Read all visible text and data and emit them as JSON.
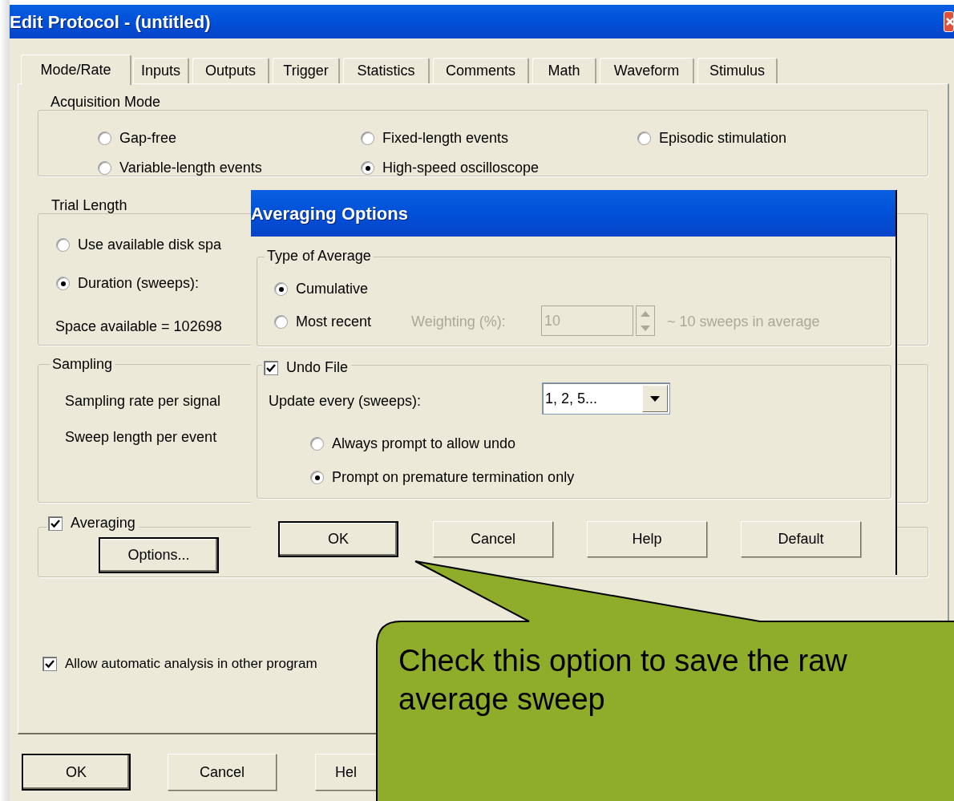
{
  "window": {
    "title": "Edit Protocol - (untitled)"
  },
  "tabs": [
    {
      "label": "Mode/Rate",
      "selected": true
    },
    {
      "label": "Inputs",
      "selected": false
    },
    {
      "label": "Outputs",
      "selected": false
    },
    {
      "label": "Trigger",
      "selected": false
    },
    {
      "label": "Statistics",
      "selected": false
    },
    {
      "label": "Comments",
      "selected": false
    },
    {
      "label": "Math",
      "selected": false
    },
    {
      "label": "Waveform",
      "selected": false
    },
    {
      "label": "Stimulus",
      "selected": false
    }
  ],
  "acquisition_mode": {
    "label": "Acquisition Mode",
    "options": [
      {
        "label": "Gap-free",
        "selected": false
      },
      {
        "label": "Fixed-length events",
        "selected": false
      },
      {
        "label": "Episodic stimulation",
        "selected": false
      },
      {
        "label": "Variable-length events",
        "selected": false
      },
      {
        "label": "High-speed oscilloscope",
        "selected": true
      }
    ]
  },
  "trial_length": {
    "label": "Trial Length",
    "options": [
      {
        "label": "Use available disk spa",
        "selected": false
      },
      {
        "label": "Duration (sweeps):",
        "selected": true
      }
    ],
    "space_text": "Space available = 102698"
  },
  "sampling": {
    "label": "Sampling",
    "rows": [
      "Sampling rate per signal",
      "Sweep length per event"
    ]
  },
  "averaging": {
    "label": "Averaging",
    "checked": true,
    "button": "Options..."
  },
  "auto_analysis": {
    "label": "Allow automatic analysis in other program",
    "checked": true
  },
  "buttons": [
    {
      "label": "OK",
      "default": true
    },
    {
      "label": "Cancel",
      "default": false
    },
    {
      "label": "Hel",
      "default": false
    }
  ],
  "averaging_dialog": {
    "title": "Averaging Options",
    "type_of_average": {
      "label": "Type of Average",
      "options": [
        {
          "label": "Cumulative",
          "selected": true
        },
        {
          "label": "Most recent",
          "selected": false
        }
      ],
      "weighting_label": "Weighting (%):",
      "weighting_value": "10",
      "weighting_hint": "~ 10 sweeps in average",
      "disabled": true
    },
    "undo_file": {
      "label": "Undo File",
      "checked": true,
      "update_label": "Update every (sweeps):",
      "update_value": "1, 2, 5...",
      "options": [
        {
          "label": "Always prompt to allow undo",
          "selected": false
        },
        {
          "label": "Prompt on premature termination only",
          "selected": true
        }
      ]
    },
    "buttons": [
      {
        "label": "OK",
        "default": true
      },
      {
        "label": "Cancel",
        "default": false
      },
      {
        "label": "Help",
        "default": false
      },
      {
        "label": "Default",
        "default": false
      }
    ]
  },
  "callout": {
    "text": "Check this option to save the raw average sweep"
  }
}
